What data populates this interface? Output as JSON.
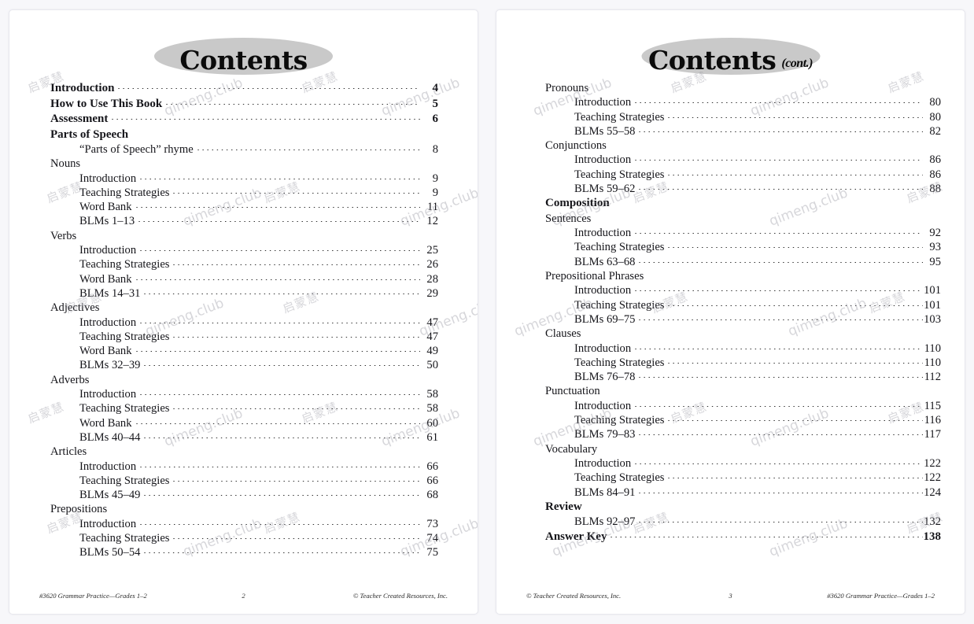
{
  "document": {
    "background_color": "#f7f7fa",
    "page_color": "#ffffff",
    "oval_color": "#c9c9c9",
    "watermark_text": "qimeng.club",
    "watermark_text_cn": "启蒙慧"
  },
  "left_page": {
    "title": "Contents",
    "title_suffix": "",
    "entries": [
      {
        "level": "h1",
        "label": "Introduction",
        "page": "4"
      },
      {
        "level": "h1",
        "label": "How to Use This Book",
        "page": "5"
      },
      {
        "level": "h1",
        "label": "Assessment",
        "page": "6"
      },
      {
        "level": "h1",
        "label": "Parts of Speech",
        "page": ""
      },
      {
        "level": "item",
        "label": "“Parts of Speech” rhyme",
        "page": "8"
      },
      {
        "level": "cat",
        "label": "Nouns",
        "page": ""
      },
      {
        "level": "item",
        "label": "Introduction",
        "page": "9"
      },
      {
        "level": "item",
        "label": "Teaching Strategies",
        "page": "9"
      },
      {
        "level": "item",
        "label": "Word Bank",
        "page": "11"
      },
      {
        "level": "item",
        "label": "BLMs 1–13",
        "page": "12"
      },
      {
        "level": "cat",
        "label": "Verbs",
        "page": ""
      },
      {
        "level": "item",
        "label": "Introduction",
        "page": "25"
      },
      {
        "level": "item",
        "label": "Teaching Strategies",
        "page": "26"
      },
      {
        "level": "item",
        "label": "Word Bank",
        "page": "28"
      },
      {
        "level": "item",
        "label": "BLMs 14–31",
        "page": "29"
      },
      {
        "level": "cat",
        "label": "Adjectives",
        "page": ""
      },
      {
        "level": "item",
        "label": "Introduction",
        "page": "47"
      },
      {
        "level": "item",
        "label": "Teaching Strategies",
        "page": "47"
      },
      {
        "level": "item",
        "label": "Word Bank",
        "page": "49"
      },
      {
        "level": "item",
        "label": "BLMs 32–39",
        "page": "50"
      },
      {
        "level": "cat",
        "label": "Adverbs",
        "page": ""
      },
      {
        "level": "item",
        "label": "Introduction",
        "page": "58"
      },
      {
        "level": "item",
        "label": "Teaching Strategies",
        "page": "58"
      },
      {
        "level": "item",
        "label": "Word Bank",
        "page": "60"
      },
      {
        "level": "item",
        "label": "BLMs 40–44",
        "page": "61"
      },
      {
        "level": "cat",
        "label": "Articles",
        "page": ""
      },
      {
        "level": "item",
        "label": "Introduction",
        "page": "66"
      },
      {
        "level": "item",
        "label": "Teaching Strategies",
        "page": "66"
      },
      {
        "level": "item",
        "label": "BLMs 45–49",
        "page": "68"
      },
      {
        "level": "cat",
        "label": "Prepositions",
        "page": ""
      },
      {
        "level": "item",
        "label": "Introduction",
        "page": "73"
      },
      {
        "level": "item",
        "label": "Teaching Strategies",
        "page": "74"
      },
      {
        "level": "item",
        "label": "BLMs 50–54",
        "page": "75"
      }
    ],
    "footer": {
      "left": "#3620 Grammar Practice—Grades 1–2",
      "middle": "2",
      "right": "© Teacher Created Resources, Inc."
    }
  },
  "right_page": {
    "title": "Contents",
    "title_suffix": "(cont.)",
    "entries": [
      {
        "level": "cat",
        "label": "Pronouns",
        "page": ""
      },
      {
        "level": "item",
        "label": "Introduction",
        "page": "80"
      },
      {
        "level": "item",
        "label": "Teaching Strategies",
        "page": "80"
      },
      {
        "level": "item",
        "label": "BLMs 55–58",
        "page": "82"
      },
      {
        "level": "cat",
        "label": "Conjunctions",
        "page": ""
      },
      {
        "level": "item",
        "label": "Introduction",
        "page": "86"
      },
      {
        "level": "item",
        "label": "Teaching Strategies",
        "page": "86"
      },
      {
        "level": "item",
        "label": "BLMs 59–62",
        "page": "88"
      },
      {
        "level": "h1",
        "label": "Composition",
        "page": ""
      },
      {
        "level": "cat",
        "label": "Sentences",
        "page": ""
      },
      {
        "level": "item",
        "label": "Introduction",
        "page": "92"
      },
      {
        "level": "item",
        "label": "Teaching Strategies",
        "page": "93"
      },
      {
        "level": "item",
        "label": "BLMs 63–68",
        "page": "95"
      },
      {
        "level": "cat",
        "label": "Prepositional Phrases",
        "page": ""
      },
      {
        "level": "item",
        "label": "Introduction",
        "page": "101"
      },
      {
        "level": "item",
        "label": "Teaching Strategies",
        "page": "101"
      },
      {
        "level": "item",
        "label": "BLMs 69–75",
        "page": "103"
      },
      {
        "level": "cat",
        "label": "Clauses",
        "page": ""
      },
      {
        "level": "item",
        "label": "Introduction",
        "page": "110"
      },
      {
        "level": "item",
        "label": "Teaching Strategies",
        "page": "110"
      },
      {
        "level": "item",
        "label": "BLMs 76–78",
        "page": "112"
      },
      {
        "level": "cat",
        "label": "Punctuation",
        "page": ""
      },
      {
        "level": "item",
        "label": "Introduction",
        "page": "115"
      },
      {
        "level": "item",
        "label": "Teaching Strategies",
        "page": "116"
      },
      {
        "level": "item",
        "label": "BLMs 79–83",
        "page": "117"
      },
      {
        "level": "cat",
        "label": "Vocabulary",
        "page": ""
      },
      {
        "level": "item",
        "label": "Introduction",
        "page": "122"
      },
      {
        "level": "item",
        "label": "Teaching Strategies",
        "page": "122"
      },
      {
        "level": "item",
        "label": "BLMs 84–91",
        "page": "124"
      },
      {
        "level": "h1",
        "label": "Review",
        "page": ""
      },
      {
        "level": "item",
        "label": "BLMs 92–97",
        "page": "132"
      },
      {
        "level": "h1",
        "label": "Answer Key",
        "page": "138"
      }
    ],
    "footer": {
      "left": "© Teacher Created Resources, Inc.",
      "middle": "3",
      "right": "#3620 Grammar Practice—Grades 1–2"
    }
  }
}
